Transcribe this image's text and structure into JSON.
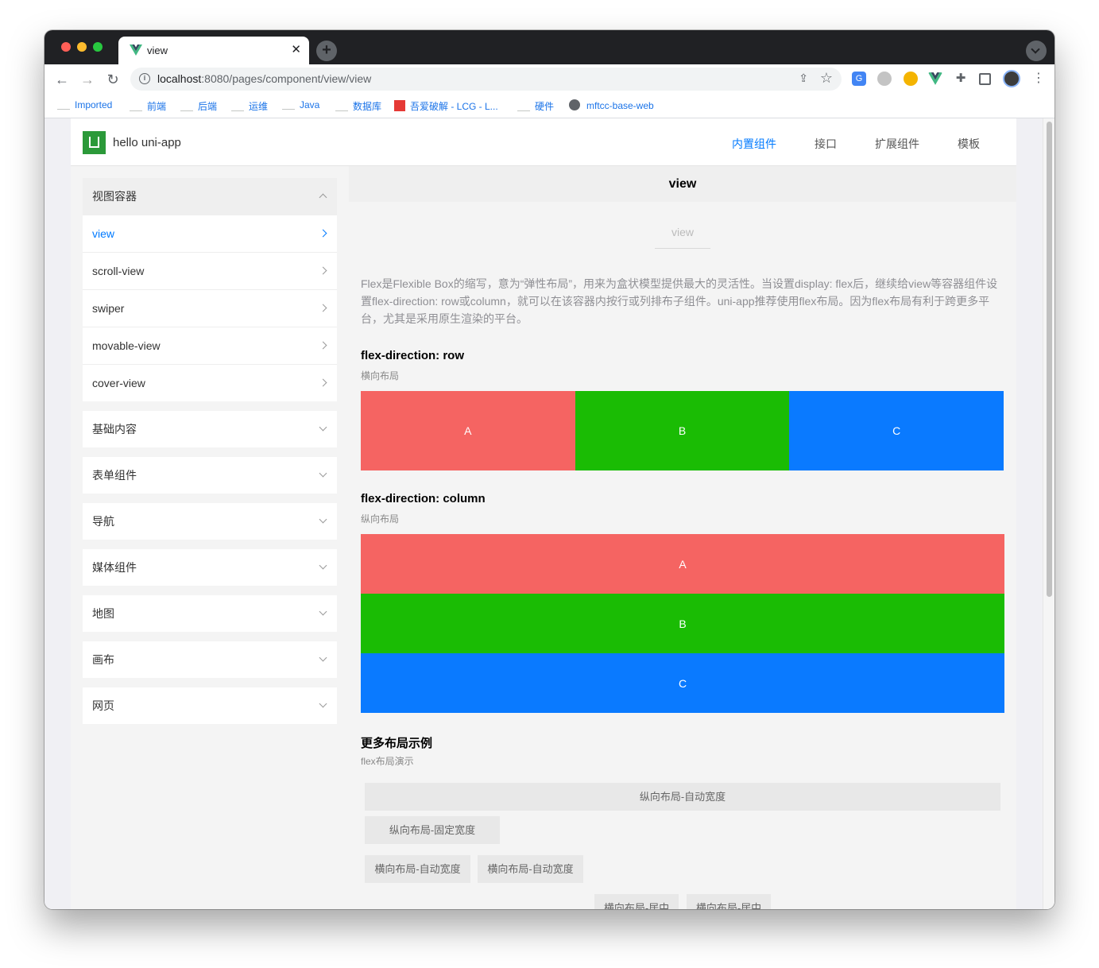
{
  "browser": {
    "tab_title": "view",
    "url_host": "localhost",
    "url_rest": ":8080/pages/component/view/view",
    "bookmarks": [
      "Imported",
      "前端",
      "后端",
      "运维",
      "Java",
      "数据库",
      "吾爱破解 - LCG - L...",
      "硬件",
      "mftcc-base-web"
    ],
    "new_tab": "+",
    "close_tab": "✕"
  },
  "app": {
    "title": "hello uni-app",
    "nav": [
      "内置组件",
      "接口",
      "扩展组件",
      "模板"
    ]
  },
  "sidebar": {
    "open_group": "视图容器",
    "open_items": [
      "view",
      "scroll-view",
      "swiper",
      "movable-view",
      "cover-view"
    ],
    "groups": [
      "基础内容",
      "表单组件",
      "导航",
      "媒体组件",
      "地图",
      "画布",
      "网页"
    ]
  },
  "content": {
    "header": "view",
    "demo_title": "view",
    "description": "Flex是Flexible Box的缩写，意为“弹性布局”，用来为盒状模型提供最大的灵活性。当设置display: flex后，继续给view等容器组件设置flex-direction: row或column，就可以在该容器内按行或列排布子组件。uni-app推荐使用flex布局。因为flex布局有利于跨更多平台，尤其是采用原生渲染的平台。",
    "row_section": {
      "title": "flex-direction: row",
      "subtitle": "横向布局",
      "boxes": [
        "A",
        "B",
        "C"
      ]
    },
    "column_section": {
      "title": "flex-direction: column",
      "subtitle": "纵向布局",
      "boxes": [
        "A",
        "B",
        "C"
      ]
    },
    "more_section": {
      "title": "更多布局示例",
      "subtitle": "flex布局演示",
      "buttons": [
        "纵向布局-自动宽度",
        "纵向布局-固定宽度",
        "横向布局-自动宽度",
        "横向布局-自动宽度",
        "横向布局-居中",
        "横向布局-居中"
      ]
    },
    "colors": {
      "A": "#f56462",
      "B": "#1abc04",
      "C": "#0a7aff",
      "accent": "#007aff"
    }
  }
}
